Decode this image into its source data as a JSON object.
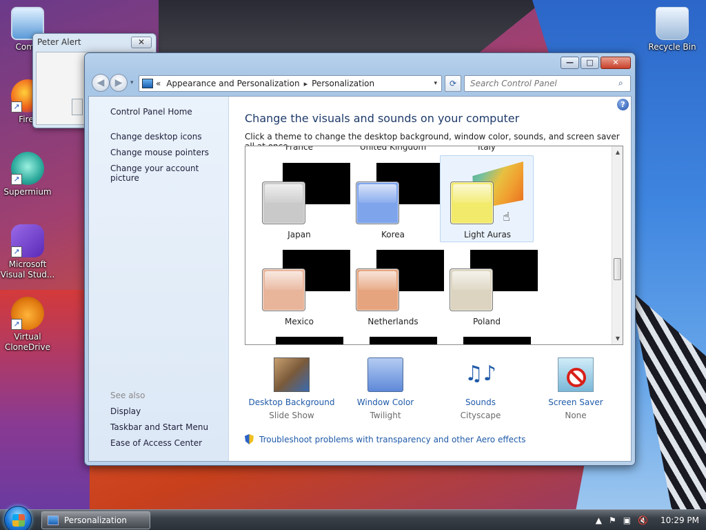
{
  "desktop": {
    "icons": [
      {
        "label": "Comp",
        "icon": "computer-icon"
      },
      {
        "label": "Firef",
        "icon": "firefox-icon"
      },
      {
        "label": "Supermium",
        "icon": "supermium-icon"
      },
      {
        "label": "Microsoft Visual Stud...",
        "icon": "visual-studio-icon"
      },
      {
        "label": "Virtual CloneDrive",
        "icon": "virtual-clonedrive-icon"
      },
      {
        "label": "Recycle Bin",
        "icon": "recycle-bin-icon"
      }
    ],
    "shortcut_glyph": "↗"
  },
  "alert_window": {
    "title": "Peter Alert",
    "close_glyph": "✕"
  },
  "window": {
    "controls": {
      "minimize": "—",
      "maximize": "□",
      "close": "✕"
    },
    "nav": {
      "back": "◀",
      "forward": "▶",
      "history": "▾"
    },
    "address": {
      "prefix": "«",
      "crumbs": [
        "Appearance and Personalization",
        "Personalization"
      ],
      "separator": "▸",
      "dropdown": "▾"
    },
    "refresh_glyph": "⟳",
    "search": {
      "placeholder": "Search Control Panel",
      "icon_glyph": "⌕"
    },
    "sidebar": {
      "home": "Control Panel Home",
      "links": [
        "Change desktop icons",
        "Change mouse pointers",
        "Change your account picture"
      ],
      "see_also_heading": "See also",
      "see_also": [
        "Display",
        "Taskbar and Start Menu",
        "Ease of Access Center"
      ]
    },
    "help_glyph": "?",
    "headline": "Change the visuals and sounds on your computer",
    "subline": "Click a theme to change the desktop background, window color, sounds, and screen saver all at once.",
    "partial_top_labels": [
      "France",
      "United Kingdom",
      "Italy"
    ],
    "themes": [
      {
        "label": "Japan",
        "glass_color": "#c9c9c9",
        "selected": false
      },
      {
        "label": "Korea",
        "glass_color": "#7ea4ec",
        "selected": false
      },
      {
        "label": "Light Auras",
        "glass_color": "#f2ea6a",
        "selected": true
      },
      {
        "label": "Mexico",
        "glass_color": "#e8b49a",
        "selected": false
      },
      {
        "label": "Netherlands",
        "glass_color": "#e6a47e",
        "selected": false
      },
      {
        "label": "Poland",
        "glass_color": "#dcd4c0",
        "selected": false
      }
    ],
    "scroll": {
      "up": "▲",
      "down": "▼"
    },
    "options": [
      {
        "name": "Desktop Background",
        "value": "Slide Show"
      },
      {
        "name": "Window Color",
        "value": "Twilight"
      },
      {
        "name": "Sounds",
        "value": "Cityscape"
      },
      {
        "name": "Screen Saver",
        "value": "None"
      }
    ],
    "sounds_glyph": "♫♪",
    "cursor_glyph": "☝",
    "troubleshoot_link": "Troubleshoot problems with transparency and other Aero effects"
  },
  "taskbar": {
    "task_label": "Personalization",
    "tray": {
      "show_hidden": "▲",
      "flag": "⚑",
      "network": "▣",
      "volume": "🔇",
      "clock": "10:29 PM"
    }
  },
  "colors": {
    "link": "#1f5aa8",
    "headline": "#1e3a6a",
    "selection_bg": "#eaf3fd"
  }
}
